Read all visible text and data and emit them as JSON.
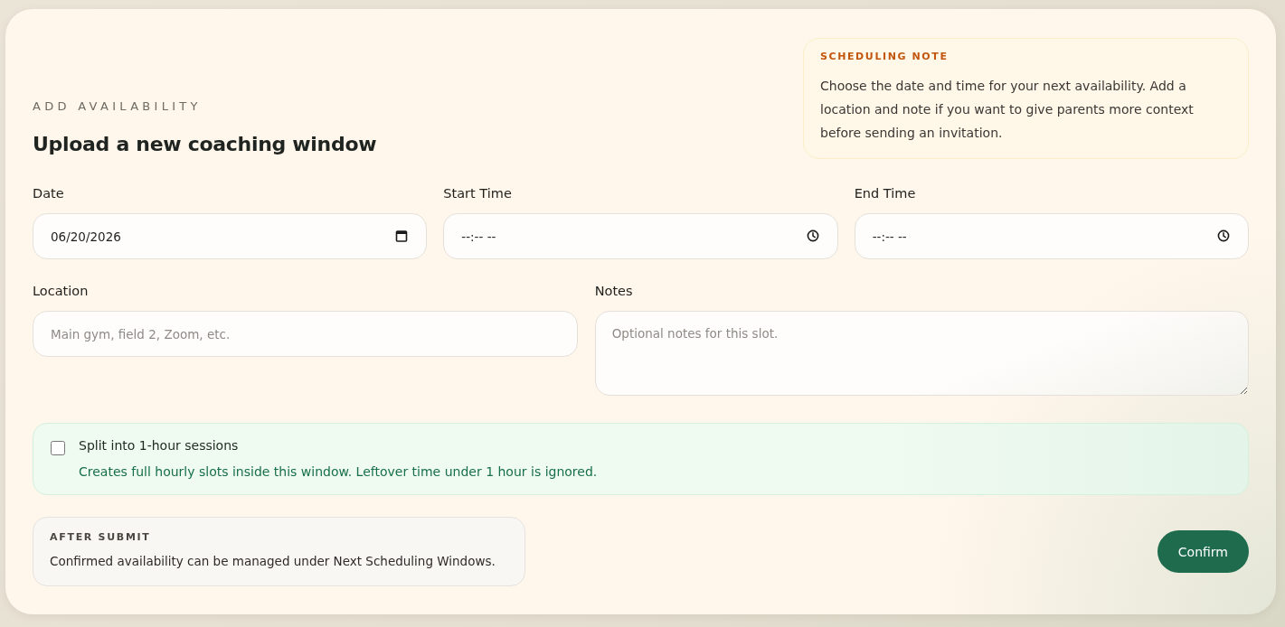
{
  "header": {
    "eyebrow": "ADD AVAILABILITY",
    "title": "Upload a new coaching window"
  },
  "note": {
    "heading": "SCHEDULING NOTE",
    "text": "Choose the date and time for your next availability. Add a location and note if you want to give parents more context before sending an invitation."
  },
  "time_fields": [
    {
      "kind": "date",
      "label": "Date",
      "value": "06/20/2026"
    },
    {
      "kind": "time",
      "label": "Start Time",
      "placeholder": "--:-- --"
    },
    {
      "kind": "time",
      "label": "End Time",
      "placeholder": "--:-- --"
    }
  ],
  "detail_fields": [
    {
      "kind": "text",
      "label": "Location",
      "placeholder": "Main gym, field 2, Zoom, etc."
    },
    {
      "kind": "textarea",
      "label": "Notes",
      "placeholder": "Optional notes for this slot."
    }
  ],
  "split_option": {
    "label": "Split into 1-hour sessions",
    "description": "Creates full hourly slots inside this window. Leftover time under 1 hour is ignored.",
    "checked": false
  },
  "after_submit": {
    "heading": "AFTER SUBMIT",
    "text": "Confirmed availability can be managed under Next Scheduling Windows."
  },
  "confirm_button": {
    "label": "Confirm"
  }
}
